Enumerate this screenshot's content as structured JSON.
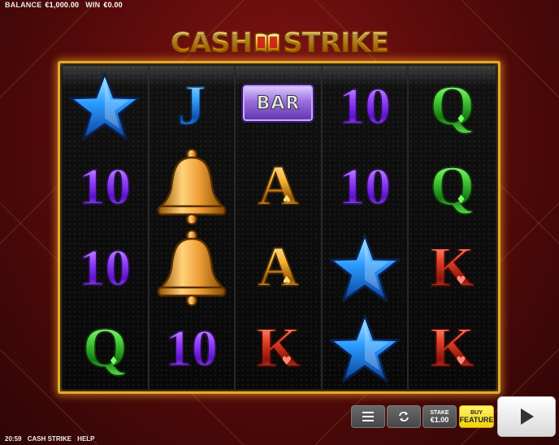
{
  "header": {
    "balance_label": "BALANCE",
    "balance_value": "€1,000.00",
    "win_label": "WIN",
    "win_value": "€0.00"
  },
  "logo": {
    "left": "CASH",
    "right": "STRIKE"
  },
  "reels": [
    [
      {
        "sym": "star"
      },
      {
        "sym": "10"
      },
      {
        "sym": "10"
      },
      {
        "sym": "Q"
      }
    ],
    [
      {
        "sym": "J"
      },
      {
        "sym": "bell"
      },
      {
        "sym": "bell"
      },
      {
        "sym": "10"
      }
    ],
    [
      {
        "sym": "BAR"
      },
      {
        "sym": "A"
      },
      {
        "sym": "A"
      },
      {
        "sym": "K"
      }
    ],
    [
      {
        "sym": "10"
      },
      {
        "sym": "10"
      },
      {
        "sym": "star"
      },
      {
        "sym": "star"
      }
    ],
    [
      {
        "sym": "Q"
      },
      {
        "sym": "Q"
      },
      {
        "sym": "K"
      },
      {
        "sym": "K"
      }
    ]
  ],
  "controls": {
    "stake_label": "STAKE",
    "stake_value": "€1.00",
    "buy_label": "BUY",
    "feature_label": "FEATURE"
  },
  "footer": {
    "time": "20:59",
    "game_name": "CASH STRIKE",
    "help": "HELP"
  },
  "colors": {
    "frame": "#e6a928",
    "buy_button": "#f3d20a",
    "background": "#5c0b0b"
  },
  "icons": [
    "menu-icon",
    "autoplay-icon",
    "play-icon",
    "book-icon"
  ]
}
